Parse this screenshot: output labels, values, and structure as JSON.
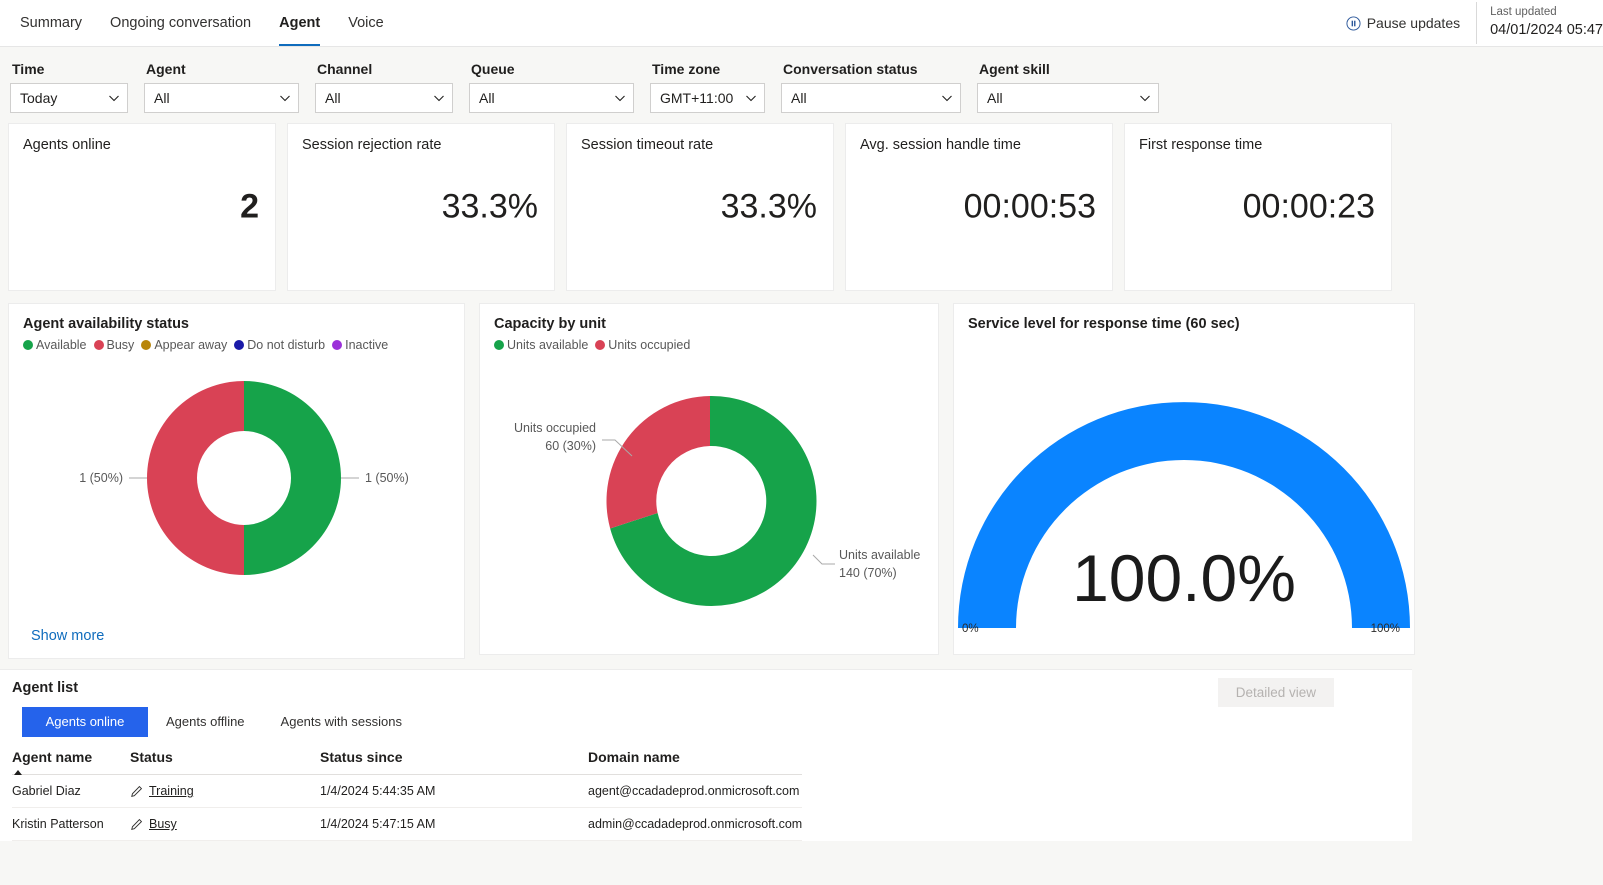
{
  "header": {
    "tabs": [
      {
        "label": "Summary",
        "active": false
      },
      {
        "label": "Ongoing conversation",
        "active": false
      },
      {
        "label": "Agent",
        "active": true
      },
      {
        "label": "Voice",
        "active": false
      }
    ],
    "pause_label": "Pause updates",
    "pause_icon": "pause-circle-icon",
    "last_updated_label": "Last updated",
    "last_updated_value": "04/01/2024 05:47"
  },
  "filters": [
    {
      "label": "Time",
      "value": "Today",
      "name": "time"
    },
    {
      "label": "Agent",
      "value": "All",
      "name": "agent"
    },
    {
      "label": "Channel",
      "value": "All",
      "name": "channel"
    },
    {
      "label": "Queue",
      "value": "All",
      "name": "queue"
    },
    {
      "label": "Time zone",
      "value": "GMT+11:00",
      "name": "timezone"
    },
    {
      "label": "Conversation status",
      "value": "All",
      "name": "conversation-status"
    },
    {
      "label": "Agent skill",
      "value": "All",
      "name": "agent-skill"
    }
  ],
  "kpis": [
    {
      "title": "Agents online",
      "value": "2"
    },
    {
      "title": "Session rejection rate",
      "value": "33.3%"
    },
    {
      "title": "Session timeout rate",
      "value": "33.3%"
    },
    {
      "title": "Avg. session handle time",
      "value": "00:00:53"
    },
    {
      "title": "First response time",
      "value": "00:00:23"
    }
  ],
  "panels": {
    "availability": {
      "title": "Agent availability status",
      "show_more": "Show more",
      "label_left": "1 (50%)",
      "label_right": "1 (50%)"
    },
    "capacity": {
      "title": "Capacity by unit",
      "label_occupied": "Units occupied",
      "label_occupied_value": "60 (30%)",
      "label_available": "Units available",
      "label_available_value": "140 (70%)"
    },
    "service_level": {
      "title": "Service level for response time (60 sec)",
      "value_text": "100.0%",
      "min_label": "0%",
      "max_label": "100%"
    }
  },
  "chart_data": [
    {
      "type": "pie",
      "name": "agent-availability-status",
      "title": "Agent availability status",
      "donut": true,
      "legend_position": "top",
      "legend": [
        "Available",
        "Busy",
        "Appear away",
        "Do not disturb",
        "Inactive"
      ],
      "colors": [
        "#16a34a",
        "#d94255",
        "#b8860b",
        "#1a1aa8",
        "#9b30d9"
      ],
      "categories": [
        "Available",
        "Busy"
      ],
      "values": [
        1,
        1
      ],
      "percents": [
        50,
        50
      ],
      "labels": [
        "1 (50%)",
        "1 (50%)"
      ]
    },
    {
      "type": "pie",
      "name": "capacity-by-unit",
      "title": "Capacity by unit",
      "donut": true,
      "legend_position": "top",
      "legend": [
        "Units available",
        "Units occupied"
      ],
      "colors": [
        "#16a34a",
        "#d94255"
      ],
      "categories": [
        "Units available",
        "Units occupied"
      ],
      "values": [
        140,
        60
      ],
      "percents": [
        70,
        30
      ],
      "labels": [
        "140 (70%)",
        "60 (30%)"
      ]
    },
    {
      "type": "bar",
      "subtype": "gauge",
      "name": "service-level-for-response-time",
      "title": "Service level for response time (60 sec)",
      "categories": [
        "Service level"
      ],
      "values": [
        100.0
      ],
      "value_text": "100.0%",
      "ylim": [
        0,
        100
      ],
      "tick_labels": [
        "0%",
        "100%"
      ],
      "color": "#0a84ff"
    }
  ],
  "agent_list": {
    "title": "Agent list",
    "detailed_view_label": "Detailed view",
    "pivots": [
      {
        "label": "Agents online",
        "selected": true
      },
      {
        "label": "Agents offline",
        "selected": false
      },
      {
        "label": "Agents with sessions",
        "selected": false
      }
    ],
    "columns": [
      "Agent name",
      "Status",
      "Status since",
      "Domain name"
    ],
    "sort_column": "Agent name",
    "sort_direction": "ascending",
    "rows": [
      {
        "agent_name": "Gabriel Diaz",
        "status": "Training",
        "status_since": "1/4/2024 5:44:35 AM",
        "domain_name": "agent@ccadadeprod.onmicrosoft.com"
      },
      {
        "agent_name": "Kristin Patterson",
        "status": "Busy",
        "status_since": "1/4/2024 5:47:15 AM",
        "domain_name": "admin@ccadadeprod.onmicrosoft.com"
      }
    ]
  },
  "colors": {
    "accent": "#0f6cbd",
    "pivot_selected": "#2563eb",
    "green": "#16a34a",
    "red": "#d94255",
    "gauge_blue": "#0a84ff"
  }
}
